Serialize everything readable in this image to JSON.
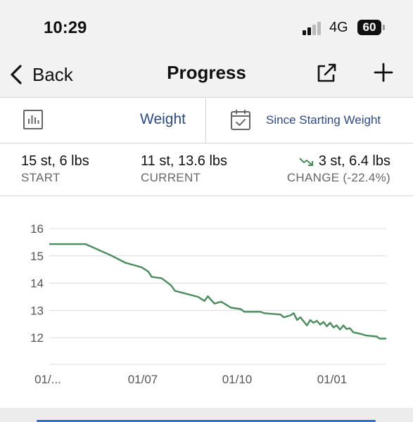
{
  "status_bar": {
    "time": "10:29",
    "network": "4G",
    "battery": "60"
  },
  "nav": {
    "back_label": "Back",
    "title": "Progress"
  },
  "selector": {
    "metric_label": "Weight",
    "range_label": "Since Starting Weight"
  },
  "stats": {
    "start_value": "15 st, 6 lbs",
    "start_label": "START",
    "current_value": "11 st, 13.6 lbs",
    "current_label": "CURRENT",
    "change_value": "3 st, 6.4 lbs",
    "change_label": "CHANGE (-22.4%)"
  },
  "colors": {
    "accent": "#2c4a8a",
    "line": "#4a8c5c",
    "bottom_bar": "#2f6fd6"
  },
  "chart_data": {
    "type": "line",
    "title": "",
    "xlabel": "",
    "ylabel": "",
    "ylim": [
      11,
      16
    ],
    "yticks": [
      16,
      15,
      14,
      13,
      12
    ],
    "xtick_labels": [
      "01/...",
      "01/07",
      "01/10",
      "01/01"
    ],
    "series": [
      {
        "values": [
          {
            "x": 0,
            "y": 15.43
          },
          {
            "x": 11,
            "y": 15.43
          },
          {
            "x": 19,
            "y": 15.0
          },
          {
            "x": 23,
            "y": 14.75
          },
          {
            "x": 28,
            "y": 14.58
          },
          {
            "x": 30,
            "y": 14.42
          },
          {
            "x": 31,
            "y": 14.23
          },
          {
            "x": 34,
            "y": 14.18
          },
          {
            "x": 36,
            "y": 14.0
          },
          {
            "x": 37,
            "y": 13.9
          },
          {
            "x": 38,
            "y": 13.72
          },
          {
            "x": 45,
            "y": 13.5
          },
          {
            "x": 47,
            "y": 13.35
          },
          {
            "x": 48,
            "y": 13.52
          },
          {
            "x": 50,
            "y": 13.25
          },
          {
            "x": 52,
            "y": 13.32
          },
          {
            "x": 53,
            "y": 13.25
          },
          {
            "x": 55,
            "y": 13.1
          },
          {
            "x": 58,
            "y": 13.05
          },
          {
            "x": 59,
            "y": 12.95
          },
          {
            "x": 64,
            "y": 12.95
          },
          {
            "x": 65,
            "y": 12.9
          },
          {
            "x": 70,
            "y": 12.85
          },
          {
            "x": 71,
            "y": 12.75
          },
          {
            "x": 73,
            "y": 12.82
          },
          {
            "x": 74,
            "y": 12.9
          },
          {
            "x": 75,
            "y": 12.65
          },
          {
            "x": 76,
            "y": 12.75
          },
          {
            "x": 77,
            "y": 12.6
          },
          {
            "x": 78,
            "y": 12.45
          },
          {
            "x": 79,
            "y": 12.65
          },
          {
            "x": 80,
            "y": 12.55
          },
          {
            "x": 81,
            "y": 12.62
          },
          {
            "x": 82,
            "y": 12.48
          },
          {
            "x": 83,
            "y": 12.58
          },
          {
            "x": 84,
            "y": 12.42
          },
          {
            "x": 85,
            "y": 12.55
          },
          {
            "x": 86,
            "y": 12.38
          },
          {
            "x": 87,
            "y": 12.45
          },
          {
            "x": 88,
            "y": 12.3
          },
          {
            "x": 89,
            "y": 12.45
          },
          {
            "x": 90,
            "y": 12.32
          },
          {
            "x": 91,
            "y": 12.35
          },
          {
            "x": 92,
            "y": 12.2
          },
          {
            "x": 94,
            "y": 12.15
          },
          {
            "x": 96,
            "y": 12.08
          },
          {
            "x": 99,
            "y": 12.05
          },
          {
            "x": 100,
            "y": 11.97
          },
          {
            "x": 102,
            "y": 11.97
          }
        ]
      }
    ],
    "grid": true
  }
}
